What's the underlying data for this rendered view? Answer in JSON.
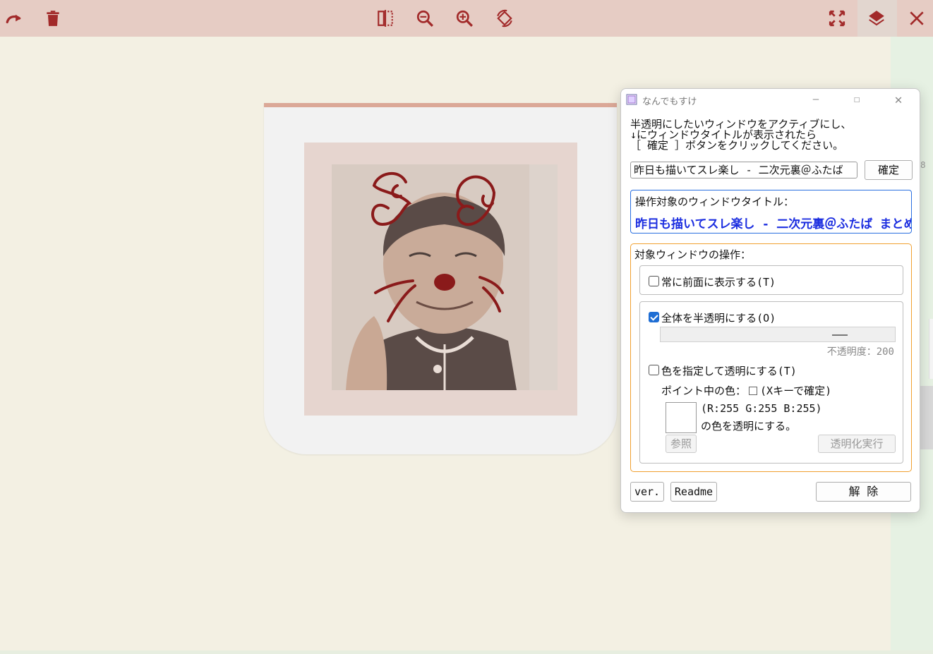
{
  "toolbar": {
    "icons": [
      "redo-icon",
      "trash-icon",
      "flip-horizontal-icon",
      "zoom-out-icon",
      "zoom-in-icon",
      "rotate-icon",
      "fullscreen-icon",
      "layers-icon",
      "close-icon"
    ],
    "accent": "#a22a2a"
  },
  "dialog": {
    "title": "なんでもすけ",
    "instructions": "半透明にしたいウィンドウをアクティブにし、\n↓にウィンドウタイトルが表示されたら\n［ 確定 ］ボタンをクリックしてください。",
    "target_input_value": "昨日も描いてスレ楽し - 二次元裏＠ふたば",
    "confirm_label": "確定",
    "target_label": "操作対象のウィンドウタイトル：",
    "target_value": "昨日も描いてスレ楽し - 二次元裏＠ふたば まとめ",
    "ops_label": "対象ウィンドウの操作：",
    "topmost_label": "常に前面に表示する(T)",
    "topmost_checked": false,
    "translucent_label": "全体を半透明にする(O)",
    "translucent_checked": true,
    "opacity_label": "不透明度：200",
    "opacity_value": 200,
    "color_label": "色を指定して透明にする(T)",
    "color_checked": false,
    "point_color_label": "ポイント中の色：",
    "point_color_hint": "(Xキーで確定)",
    "rgb_text": "(R:255 G:255 B:255)",
    "make_transparent_text": "の色を透明にする。",
    "browse_label": "参照",
    "execute_label": "透明化実行",
    "ver_label": "ver.",
    "readme_label": "Readme",
    "release_label": "解 除"
  }
}
